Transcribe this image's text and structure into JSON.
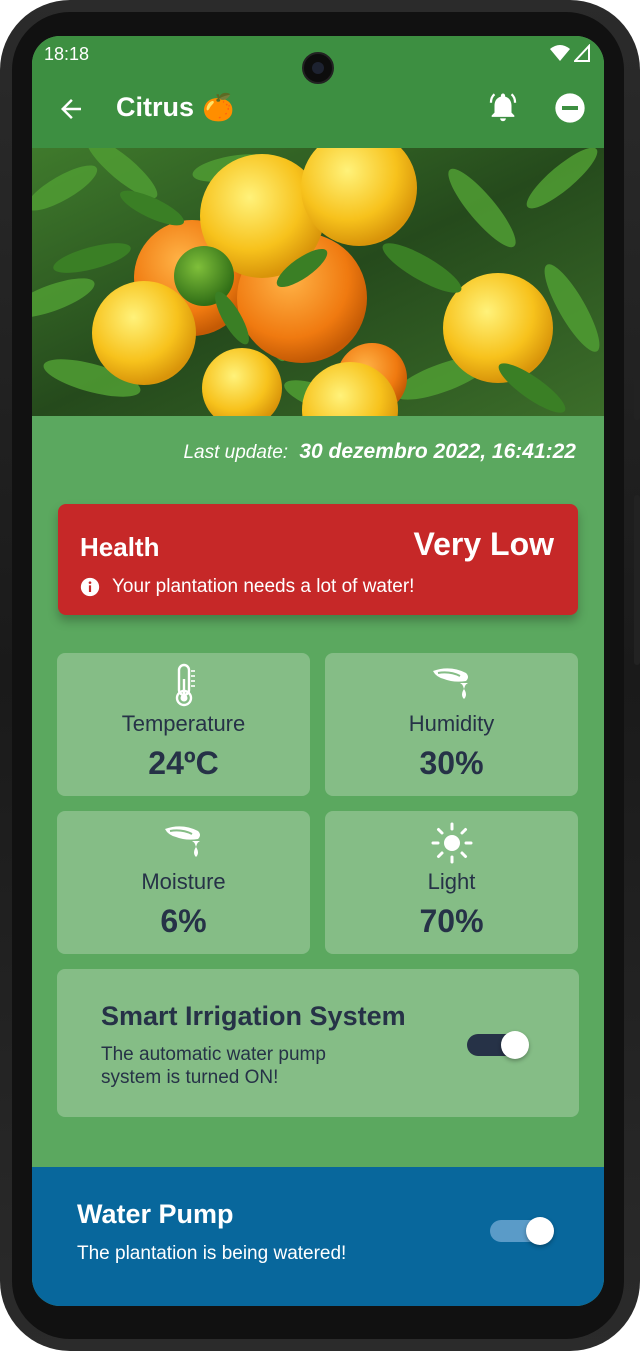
{
  "status_bar": {
    "time": "18:18"
  },
  "app_bar": {
    "title": "Citrus",
    "title_emoji": "🍊",
    "icons": [
      "back-arrow-icon",
      "alarm-bell-icon",
      "minus-circle-icon"
    ]
  },
  "hero_image": {
    "subject": "orange tree with ripe citrus fruits"
  },
  "last_update": {
    "label": "Last update:",
    "value": "30 dezembro 2022, 16:41:22"
  },
  "health": {
    "title": "Health",
    "level": "Very Low",
    "message": "Your plantation needs a lot of water!",
    "color": "#c62828"
  },
  "sensors": [
    {
      "label": "Temperature",
      "value": "24ºC",
      "icon": "thermometer-icon"
    },
    {
      "label": "Humidity",
      "value": "30%",
      "icon": "humidity-icon"
    },
    {
      "label": "Moisture",
      "value": "6%",
      "icon": "moisture-icon"
    },
    {
      "label": "Light",
      "value": "70%",
      "icon": "sun-icon"
    }
  ],
  "smart_irrigation": {
    "title": "Smart Irrigation System",
    "description": "The automatic water pump system is turned ON!",
    "enabled": true
  },
  "water_pump": {
    "title": "Water Pump",
    "description": "The plantation is being watered!",
    "enabled": true
  },
  "colors": {
    "app_bar": "#3d8f41",
    "background": "#5ba85f",
    "card": "#85bd86",
    "text_dark": "#263247",
    "pump_bar": "#08679c"
  }
}
